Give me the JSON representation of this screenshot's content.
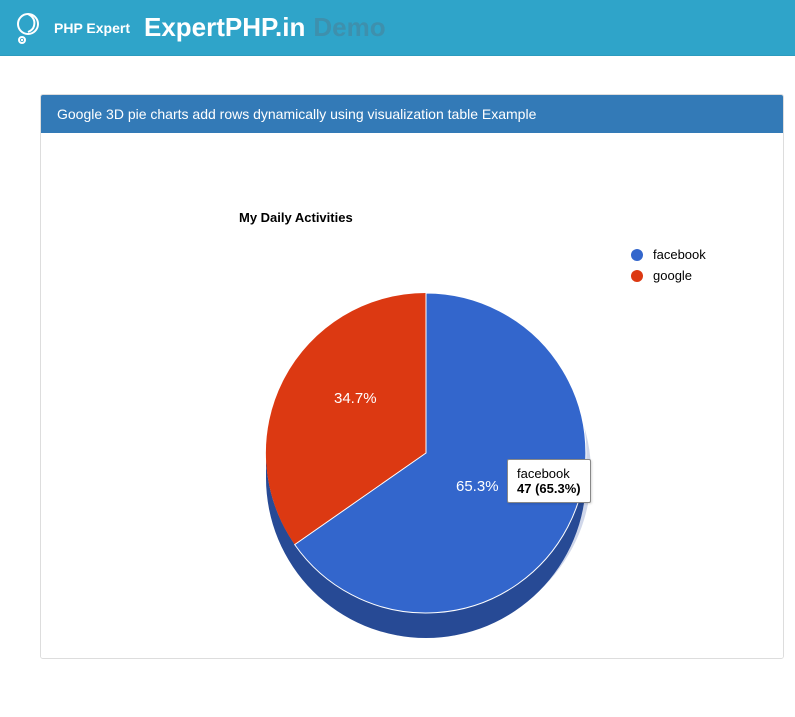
{
  "header": {
    "logo_label": "PHP Expert",
    "brand": "ExpertPHP.in",
    "demo": "Demo"
  },
  "panel": {
    "title": "Google 3D pie charts add rows dynamically using visualization table Example"
  },
  "chart_data": {
    "type": "pie",
    "title": "My Daily Activities",
    "series": [
      {
        "name": "facebook",
        "value": 47,
        "percent": 65.3,
        "color": "#3366cc"
      },
      {
        "name": "google",
        "value": 25,
        "percent": 34.7,
        "color": "#dc3912"
      }
    ],
    "legend_position": "right"
  },
  "tooltip": {
    "name": "facebook",
    "value_text": "47 (65.3%)"
  },
  "slice_labels": {
    "blue": "65.3%",
    "red": "34.7%"
  }
}
